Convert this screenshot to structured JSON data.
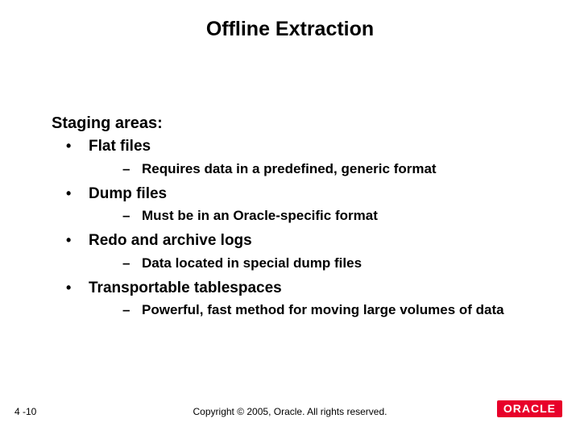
{
  "slide": {
    "title": "Offline Extraction",
    "heading": "Staging areas:",
    "items": [
      {
        "label": "Flat files",
        "sub": "Requires data in a predefined, generic format"
      },
      {
        "label": "Dump files",
        "sub": "Must be in an Oracle-specific format"
      },
      {
        "label": "Redo and archive logs",
        "sub": "Data located in special dump files"
      },
      {
        "label": "Transportable tablespaces",
        "sub": "Powerful, fast method for moving large volumes of data"
      }
    ],
    "page_number": "4 -10",
    "copyright": "Copyright © 2005, Oracle.  All rights reserved.",
    "logo_text": "ORACLE"
  }
}
